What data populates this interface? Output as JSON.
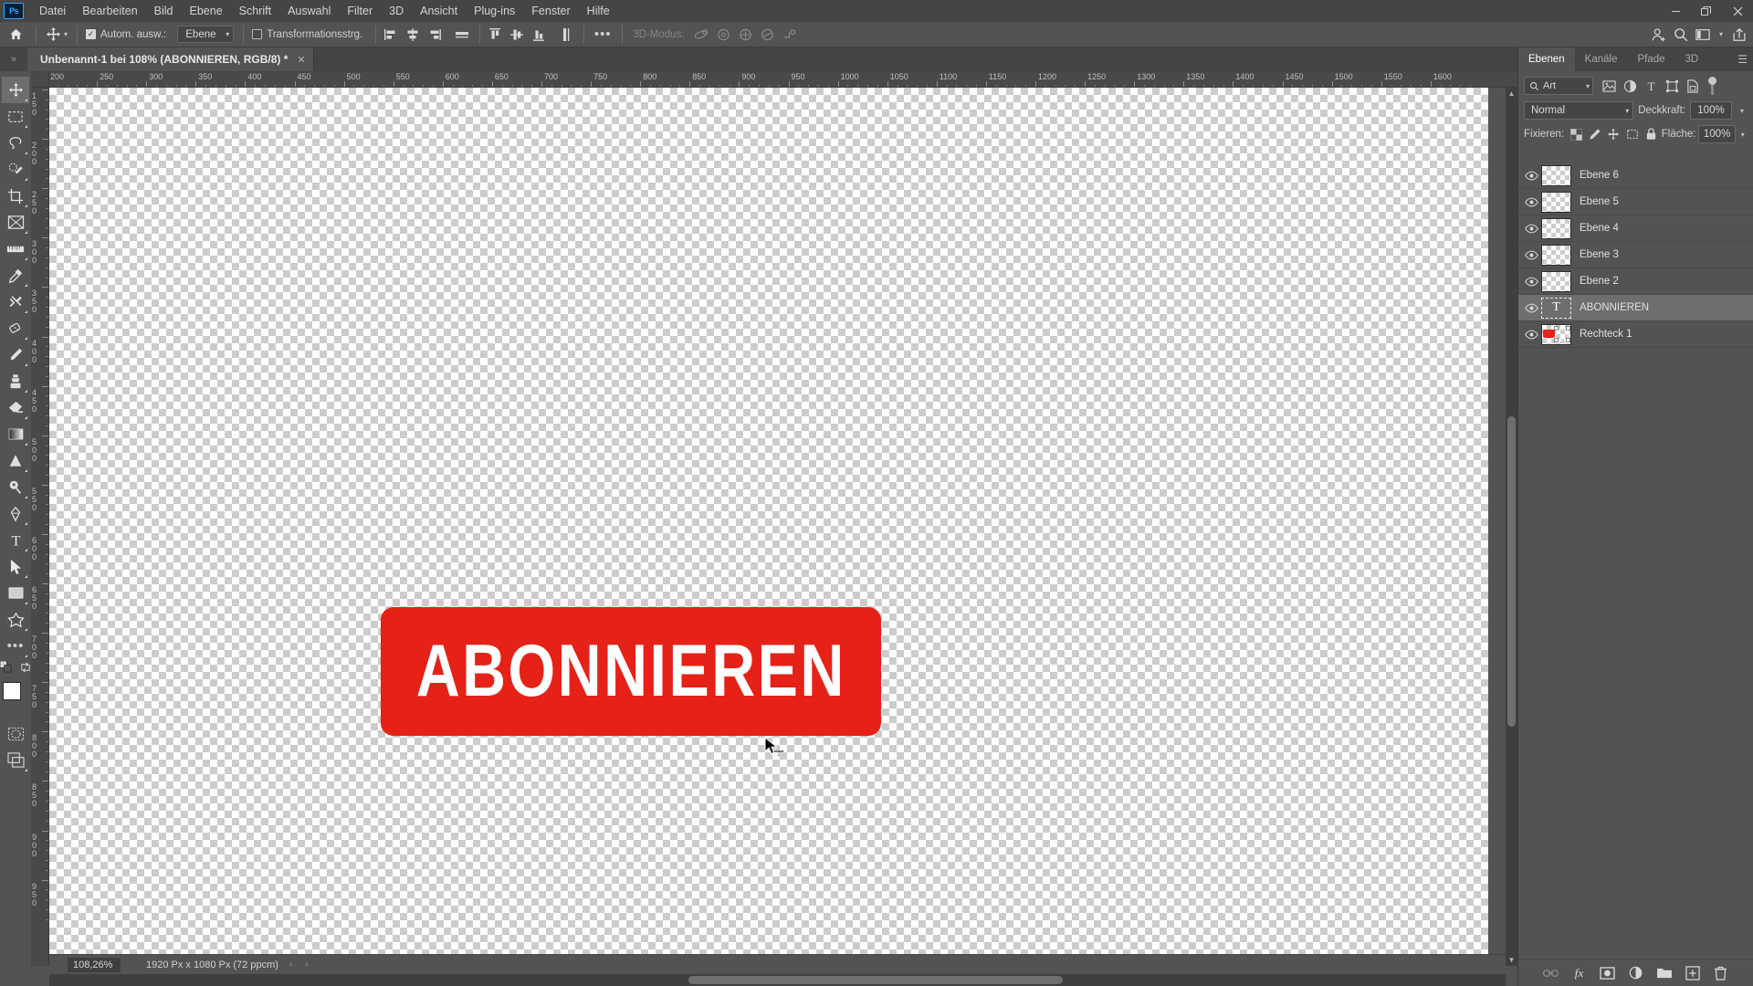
{
  "app": {
    "name": "Photoshop",
    "logo_text": "Ps",
    "accent": "#31a8ff",
    "chrome_bg": "#535353"
  },
  "menubar": {
    "items": [
      {
        "label": "Datei"
      },
      {
        "label": "Bearbeiten"
      },
      {
        "label": "Bild"
      },
      {
        "label": "Ebene"
      },
      {
        "label": "Schrift"
      },
      {
        "label": "Auswahl"
      },
      {
        "label": "Filter"
      },
      {
        "label": "3D"
      },
      {
        "label": "Ansicht"
      },
      {
        "label": "Plug-ins"
      },
      {
        "label": "Fenster"
      },
      {
        "label": "Hilfe"
      }
    ],
    "window_controls": {
      "minimize": "—",
      "maximize": "❐",
      "close": "✕"
    }
  },
  "options_bar": {
    "home_icon": "home-icon",
    "tool_icon": "move-tool-icon",
    "auto_select": {
      "label": "Autom. ausw.:",
      "checked": true
    },
    "auto_select_scope": "Ebene",
    "transform_controls": {
      "label": "Transformationsstrg.",
      "checked": false
    },
    "align_icons": [
      "align-left-edges-icon",
      "align-horizontal-centers-icon",
      "align-right-edges-icon",
      "distribute-horizontal-icon"
    ],
    "align_icons2": [
      "align-top-edges-icon",
      "align-vertical-centers-icon",
      "align-bottom-edges-icon",
      "distribute-vertical-icon"
    ],
    "more_label": "•••",
    "threed_mode_label": "3D-Modus:",
    "threed_icons": [
      "orbit-3d-icon",
      "roll-3d-icon",
      "pan-3d-icon",
      "slide-3d-icon",
      "scale-3d-icon"
    ],
    "right_icons": [
      "share-user-icon",
      "search-icon",
      "workspace-icon",
      "chevron-down-icon",
      "export-icon"
    ]
  },
  "document": {
    "tab_title": "Unbenannt-1 bei 108% (ABONNIEREN, RGB/8) *",
    "close_glyph": "✕",
    "collapse_glyph": "»"
  },
  "toolbar": {
    "tools": [
      {
        "name": "move-tool",
        "label": "Verschieben",
        "active": true
      },
      {
        "name": "rectangular-marquee-tool",
        "label": "Auswahlrechteck",
        "active": false
      },
      {
        "name": "lasso-tool",
        "label": "Lasso",
        "active": false
      },
      {
        "name": "quick-selection-tool",
        "label": "Schnellauswahl",
        "active": false
      },
      {
        "name": "crop-tool",
        "label": "Freistellungswerkzeug",
        "active": false
      },
      {
        "name": "frame-tool",
        "label": "Rahmenwerkzeug",
        "active": false
      },
      {
        "name": "ruler-tool",
        "label": "Mess-Werkzeug",
        "active": false
      },
      {
        "name": "eyedropper-tool",
        "label": "Pipette",
        "active": false
      },
      {
        "name": "healing-brush-tool",
        "label": "Reparatur-Pinsel",
        "active": false
      },
      {
        "name": "patch-tool",
        "label": "Ausbessern",
        "active": false
      },
      {
        "name": "brush-tool",
        "label": "Pinsel",
        "active": false
      },
      {
        "name": "clone-stamp-tool",
        "label": "Kopierstempel",
        "active": false
      },
      {
        "name": "eraser-tool",
        "label": "Radiergummi",
        "active": false
      },
      {
        "name": "gradient-tool",
        "label": "Verlauf",
        "active": false
      },
      {
        "name": "sharpen-tool",
        "label": "Scharfzeichner",
        "active": false
      },
      {
        "name": "dodge-tool",
        "label": "Abwedler",
        "active": false
      },
      {
        "name": "pen-tool",
        "label": "Zeichenstift",
        "active": false
      },
      {
        "name": "type-tool",
        "label": "Text",
        "active": false
      },
      {
        "name": "path-selection-tool",
        "label": "Pfadauswahl",
        "active": false
      },
      {
        "name": "rectangle-tool",
        "label": "Rechteck",
        "active": false
      },
      {
        "name": "custom-shape-tool",
        "label": "Eigene Form",
        "active": false
      },
      {
        "name": "more-tools",
        "label": "•••",
        "active": false
      }
    ],
    "foreground_color": "#ffffff",
    "background_color": "#ffffff",
    "quick_mask_label": "quick-mask-icon",
    "screen_mode_label": "screen-mode-icon"
  },
  "canvas": {
    "ruler_h_start": 200,
    "ruler_h_step": 50,
    "ruler_h_labels": [
      200,
      250,
      300,
      350,
      400,
      450,
      500,
      550,
      600,
      650,
      700,
      750,
      800,
      850,
      900,
      950,
      1000,
      1050,
      1100,
      1150,
      1200,
      1250,
      1300,
      1350,
      1400,
      1450,
      1500,
      1550,
      1600
    ],
    "ruler_v_labels": [
      150,
      200,
      250,
      300,
      350,
      400,
      450,
      500,
      550,
      600,
      650,
      700,
      750,
      800,
      850,
      900,
      950
    ],
    "subscribe_button": {
      "text": "ABONNIEREN",
      "fill_color": "#e62117",
      "text_color": "#ffffff"
    },
    "cursor": "move-cursor"
  },
  "statusbar": {
    "zoom": "108,26%",
    "dimensions": "1920 Px x 1080 Px (72 ppcm)",
    "arrow_right": "›",
    "arrow_left": "‹"
  },
  "layers_panel": {
    "tabs": [
      {
        "label": "Ebenen",
        "active": true
      },
      {
        "label": "Kanäle",
        "active": false
      },
      {
        "label": "Pfade",
        "active": false
      },
      {
        "label": "3D",
        "active": false
      }
    ],
    "menu_glyph": "☰",
    "filter": {
      "label": "Art",
      "search_icon": "search-icon",
      "chevron": "⌄",
      "kind_icons": [
        "filter-pixel-icon",
        "filter-adjustment-icon",
        "filter-type-icon",
        "filter-shape-icon",
        "filter-smart-object-icon"
      ]
    },
    "blend_mode": "Normal",
    "opacity": {
      "label": "Deckkraft:",
      "value": "100%"
    },
    "fill": {
      "label": "Fläche:",
      "value": "100%"
    },
    "lock": {
      "label": "Fixieren:",
      "icons": [
        "lock-transparent-pixels-icon",
        "lock-image-pixels-icon",
        "lock-position-icon",
        "lock-artboard-nesting-icon",
        "lock-all-icon"
      ]
    },
    "layers": [
      {
        "name": "Ebene 6",
        "kind": "pixel",
        "visible": true,
        "selected": false
      },
      {
        "name": "Ebene 5",
        "kind": "pixel",
        "visible": true,
        "selected": false
      },
      {
        "name": "Ebene 4",
        "kind": "pixel",
        "visible": true,
        "selected": false
      },
      {
        "name": "Ebene 3",
        "kind": "pixel",
        "visible": true,
        "selected": false
      },
      {
        "name": "Ebene 2",
        "kind": "pixel",
        "visible": true,
        "selected": false
      },
      {
        "name": "ABONNIEREN",
        "kind": "text",
        "visible": true,
        "selected": true
      },
      {
        "name": "Rechteck 1",
        "kind": "shape",
        "visible": true,
        "selected": false
      }
    ],
    "bottom_icons": [
      "link-layers-icon",
      "layer-style-fx-icon",
      "add-layer-mask-icon",
      "new-adjustment-layer-icon",
      "new-group-icon",
      "new-layer-icon",
      "delete-layer-icon"
    ]
  }
}
